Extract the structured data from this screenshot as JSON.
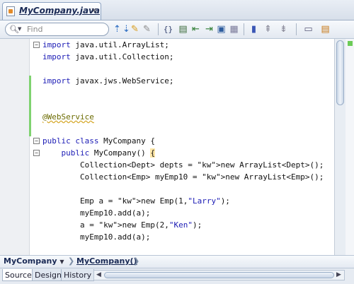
{
  "tab": {
    "title": "MyCompany.java",
    "close": "×"
  },
  "search": {
    "placeholder": "Find",
    "icon": "search-icon"
  },
  "toolbar": {
    "icons": [
      "search-dropdown-icon",
      "find-previous-icon",
      "find-next-icon",
      "highlight-icon",
      "toggle-highlight-icon",
      "match-brace-icon",
      "toggle-comment-icon",
      "shift-left-icon",
      "shift-right-icon",
      "start-macro-icon",
      "bookmark-icon",
      "previous-bookmark-icon",
      "next-bookmark-icon",
      "diff-icon",
      "properties-icon"
    ]
  },
  "code": {
    "lines": [
      "import java.util.ArrayList;",
      "import java.util.Collection;",
      "",
      "import javax.jws.WebService;",
      "",
      "",
      "@WebService",
      "",
      "public class MyCompany {",
      "    public MyCompany() {",
      "        Collection<Dept> depts = new ArrayList<Dept>();",
      "        Collection<Emp> myEmp10 = new ArrayList<Emp>();",
      "",
      "        Emp a = new Emp(1,\"Larry\");",
      "        myEmp10.add(a);",
      "        a = new Emp(2,\"Ken\");",
      "        myEmp10.add(a);"
    ]
  },
  "breadcrumb": {
    "class": "MyCompany",
    "method": "MyCompany()"
  },
  "bottom_tabs": [
    "Source",
    "Design",
    "History"
  ],
  "colors": {
    "keyword": "#1b1bb5",
    "change_bar": "#7fd26f",
    "annotation_underline": "#d3a21b"
  }
}
